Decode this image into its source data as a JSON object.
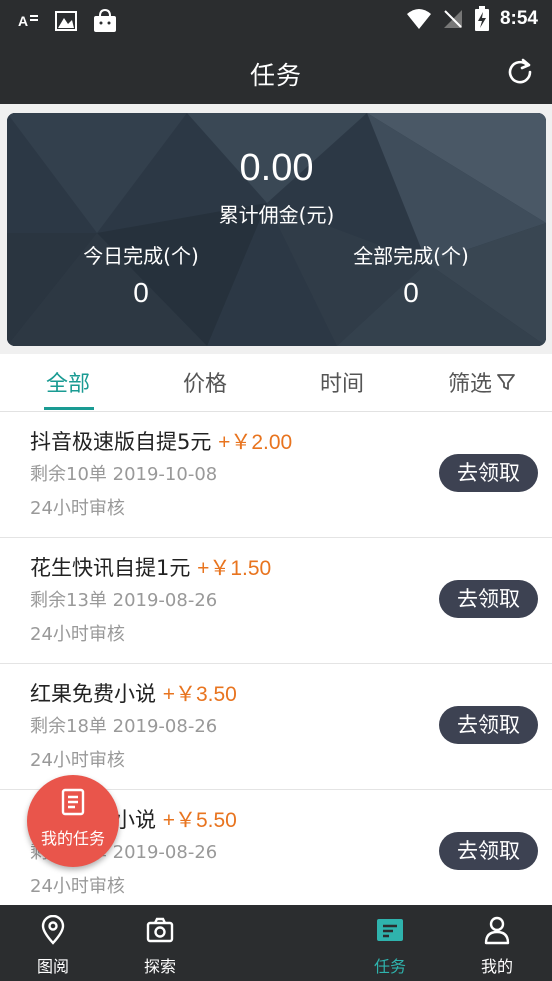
{
  "status_bar": {
    "time": "8:54"
  },
  "app_bar": {
    "title": "任务"
  },
  "stats": {
    "total_amount": "0.00",
    "total_label": "累计佣金(元)",
    "today_label": "今日完成(个)",
    "today_value": "0",
    "all_label": "全部完成(个)",
    "all_value": "0"
  },
  "tabs": [
    {
      "label": "全部"
    },
    {
      "label": "价格"
    },
    {
      "label": "时间"
    },
    {
      "label": "筛选"
    }
  ],
  "tasks": [
    {
      "title": "抖音极速版自提5元",
      "price": "+￥2.00",
      "meta": "剩余10单 2019-10-08",
      "review": "24小时审核",
      "button": "去领取"
    },
    {
      "title": "花生快讯自提1元",
      "price": "+￥1.50",
      "meta": "剩余13单 2019-08-26",
      "review": "24小时审核",
      "button": "去领取"
    },
    {
      "title": "红果免费小说",
      "price": "+￥3.50",
      "meta": "剩余18单 2019-08-26",
      "review": "24小时审核",
      "button": "去领取"
    },
    {
      "title": "番茄免费小说",
      "price": "+￥5.50",
      "meta": "剩余18单 2019-08-26",
      "review": "24小时审核",
      "button": "去领取"
    }
  ],
  "fab": {
    "label": "我的任务"
  },
  "bottom_nav": [
    {
      "label": "图阅",
      "icon": "map-pin-icon"
    },
    {
      "label": "探索",
      "icon": "camera-icon"
    },
    {
      "label": "任务",
      "icon": "task-icon"
    },
    {
      "label": "我的",
      "icon": "person-icon"
    }
  ],
  "colors": {
    "accent": "#1a9b93",
    "price": "#e8741f",
    "fab": "#e9554b",
    "button": "#3d4252"
  }
}
